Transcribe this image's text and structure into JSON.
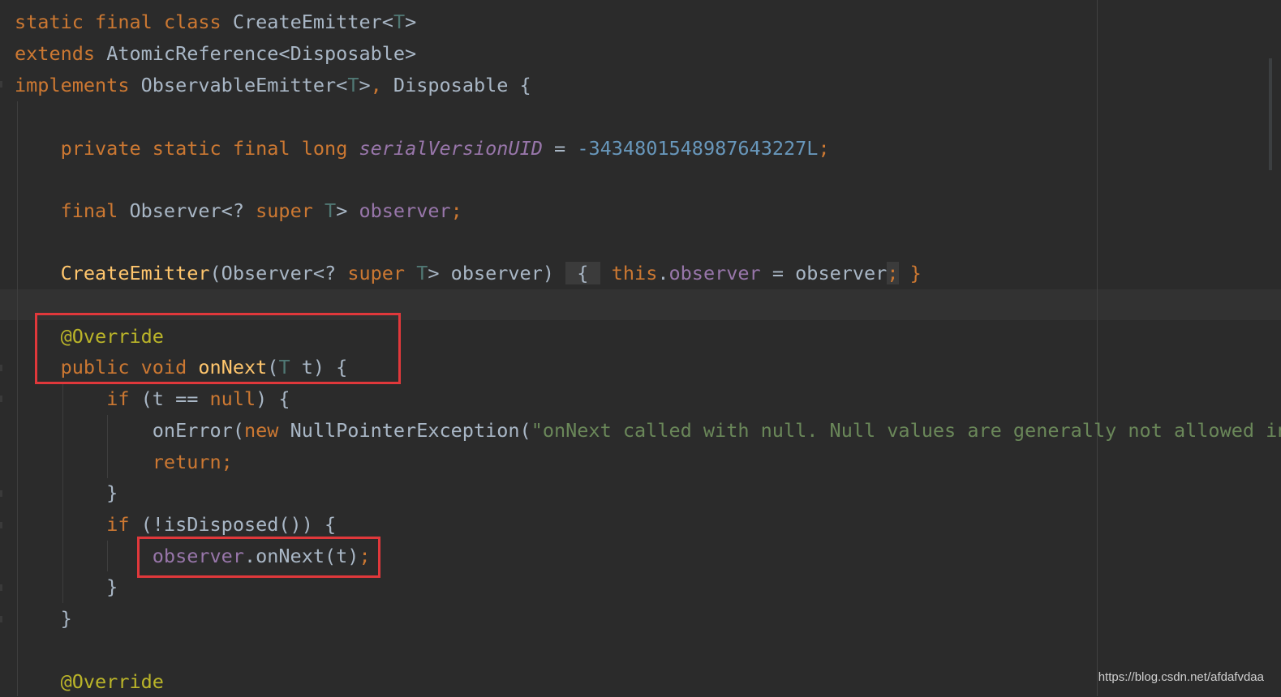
{
  "editor": {
    "lines": [
      "static final class CreateEmitter<T>",
      "extends AtomicReference<Disposable>",
      "implements ObservableEmitter<T>, Disposable {",
      "",
      "    private static final long serialVersionUID = -3434801548987643227L;",
      "",
      "    final Observer<? super T> observer;",
      "",
      "    CreateEmitter(Observer<? super T> observer) { this.observer = observer; }",
      "",
      "    @Override",
      "    public void onNext(T t) {",
      "        if (t == null) {",
      "            onError(new NullPointerException(\"onNext called with null. Null values are generally not allowed in",
      "            return;",
      "        }",
      "        if (!isDisposed()) {",
      "            observer.onNext(t);",
      "        }",
      "    }",
      "",
      "    @Override"
    ]
  },
  "colors": {
    "background": "#2b2b2b",
    "keyword": "#cc7832",
    "type_param": "#507874",
    "field": "#9876aa",
    "number": "#6897bb",
    "string": "#6a8759",
    "method": "#ffc66d",
    "annotation": "#bbb529",
    "text": "#a9b7c6",
    "highlight_box": "#e0383b"
  },
  "watermark": "https://blog.csdn.net/afdafvdaa"
}
